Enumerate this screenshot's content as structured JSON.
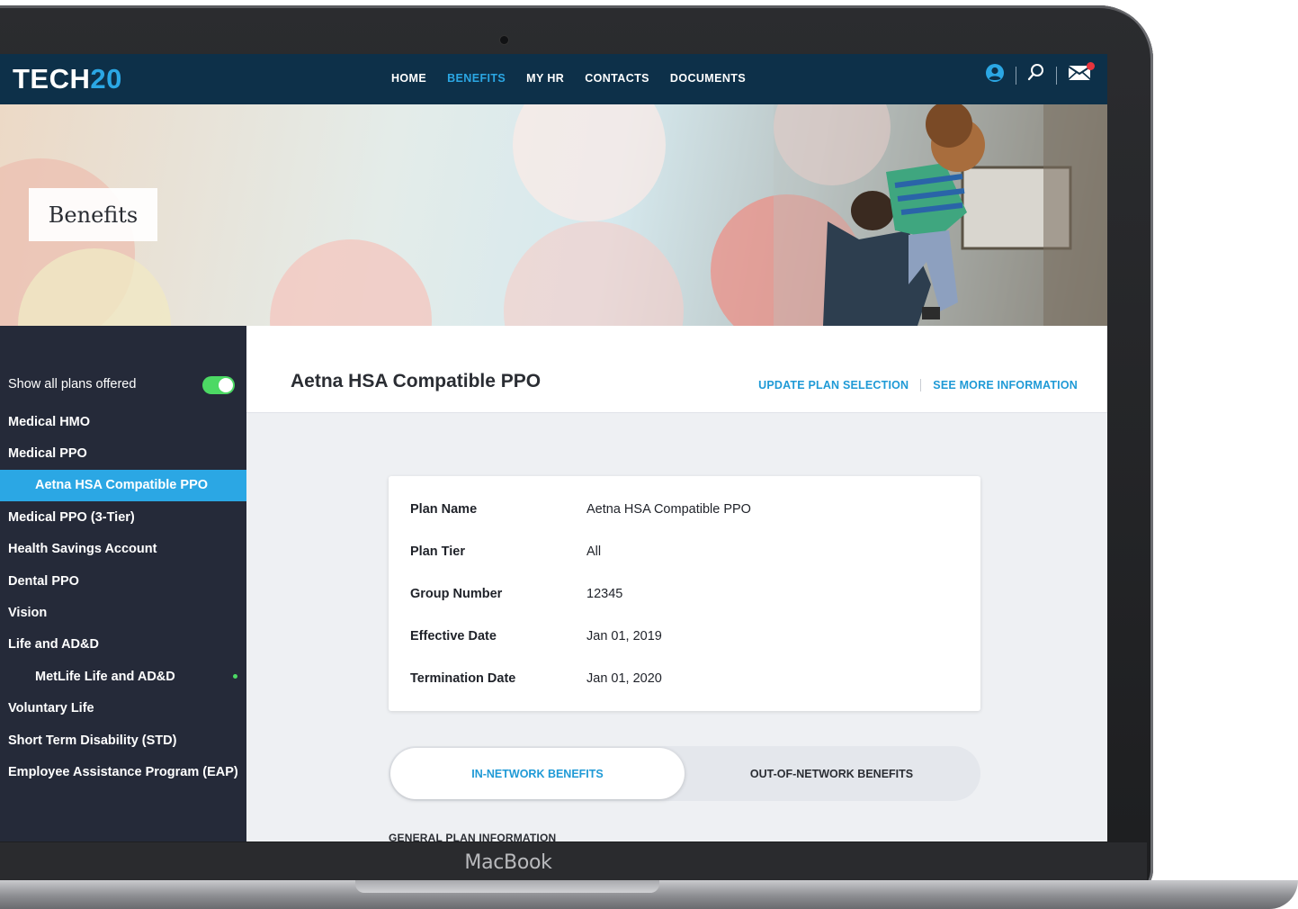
{
  "device": {
    "label": "MacBook"
  },
  "nav": {
    "logo_part1": "TECH",
    "logo_part2": "20",
    "links": [
      "HOME",
      "BENEFITS",
      "MY HR",
      "CONTACTS",
      "DOCUMENTS"
    ],
    "active_link": "BENEFITS",
    "icons": [
      "user-icon",
      "search-icon",
      "mail-icon"
    ],
    "accent_color": "#2ba7e4",
    "bar_color": "#0d3049"
  },
  "hero": {
    "title": "Benefits"
  },
  "sidebar": {
    "toggle_label": "Show all plans offered",
    "toggle_on": true,
    "items": [
      {
        "label": "Medical HMO",
        "sub": false,
        "active": false
      },
      {
        "label": "Medical PPO",
        "sub": false,
        "active": false
      },
      {
        "label": "Aetna HSA Compatible PPO",
        "sub": true,
        "active": true
      },
      {
        "label": "Medical PPO (3-Tier)",
        "sub": false,
        "active": false
      },
      {
        "label": "Health Savings Account",
        "sub": false,
        "active": false
      },
      {
        "label": "Dental PPO",
        "sub": false,
        "active": false
      },
      {
        "label": "Vision",
        "sub": false,
        "active": false
      },
      {
        "label": "Life and AD&D",
        "sub": false,
        "active": false
      },
      {
        "label": "MetLife Life and AD&D",
        "sub": true,
        "active": false,
        "dot": true
      },
      {
        "label": "Voluntary Life",
        "sub": false,
        "active": false
      },
      {
        "label": "Short Term Disability (STD)",
        "sub": false,
        "active": false
      },
      {
        "label": "Employee Assistance Program (EAP)",
        "sub": false,
        "active": false
      }
    ]
  },
  "main": {
    "plan_title": "Aetna HSA Compatible PPO",
    "update_link": "UPDATE PLAN SELECTION",
    "more_link": "SEE MORE INFORMATION",
    "details": [
      {
        "key": "Plan Name",
        "value": "Aetna HSA Compatible PPO"
      },
      {
        "key": "Plan Tier",
        "value": "All"
      },
      {
        "key": "Group Number",
        "value": "12345"
      },
      {
        "key": "Effective Date",
        "value": "Jan 01, 2019"
      },
      {
        "key": "Termination Date",
        "value": "Jan 01, 2020"
      }
    ],
    "tabs": [
      "IN-NETWORK BENEFITS",
      "OUT-OF-NETWORK BENEFITS"
    ],
    "active_tab": "IN-NETWORK BENEFITS",
    "section_label": "GENERAL PLAN INFORMATION"
  }
}
